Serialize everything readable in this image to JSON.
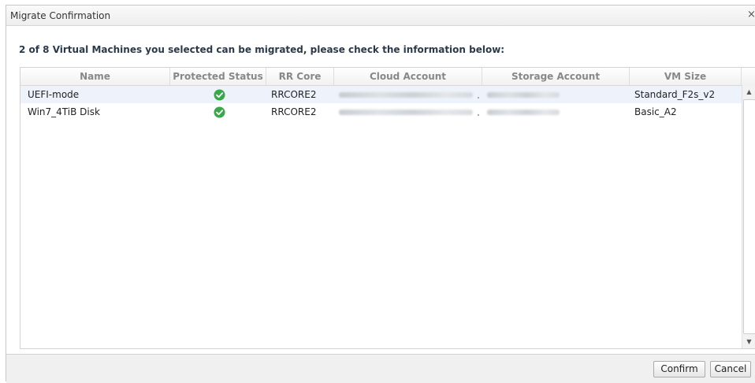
{
  "dialog": {
    "title": "Migrate Confirmation",
    "close_glyph": "×",
    "message": "2 of 8 Virtual Machines you selected can be migrated, please check the information below:"
  },
  "table": {
    "columns": [
      "Name",
      "Protected Status",
      "RR Core",
      "Cloud Account",
      "Storage Account",
      "VM Size"
    ],
    "rows": [
      {
        "name": "UEFI-mode",
        "status_icon": "check-circle-icon",
        "rr_core": "RRCORE2",
        "cloud_account": "redacted",
        "storage_account": "redacted",
        "vm_size": "Standard_F2s_v2"
      },
      {
        "name": "Win7_4TiB Disk",
        "status_icon": "check-circle-icon",
        "rr_core": "RRCORE2",
        "cloud_account": "redacted",
        "storage_account": "redacted",
        "vm_size": "Basic_A2"
      }
    ]
  },
  "scrollbar": {
    "up_glyph": "▲",
    "down_glyph": "▼"
  },
  "buttons": {
    "confirm": "Confirm",
    "cancel": "Cancel"
  },
  "colors": {
    "ok_green": "#3aa84a",
    "selected_row": "#eef3fb"
  }
}
